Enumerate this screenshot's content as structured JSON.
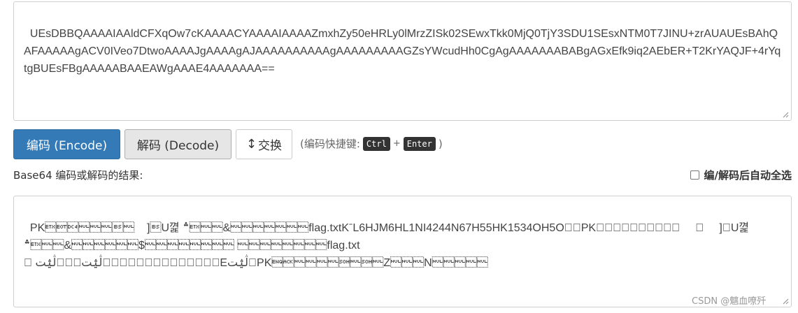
{
  "input": {
    "text": "UEsDBBQAAAAIAAldCFXqOw7cKAAAACYAAAAIAAAAZmxhZy50eHRLy0lMrzZISk02SEwxTkk0MjQ0TjY3SDU1SEsxNTM0T7JINU+zrAUAUEsBAhQAFAAAAAgACV0IVeo7DtwoAAAAJgAAAAgAJAAAAAAAAAAgAAAAAAAAAGZsYWcudHh0CgAgAAAAAAABABgAGxEfk9iq2AEbER+T2KrYAQJF+4rYqtgBUEsFBgAAAAABAAEAWgAAAE4AAAAAAA=="
  },
  "buttons": {
    "encode": "编码 (Encode)",
    "decode": "解码 (Decode)",
    "swap_arrow": "↕",
    "swap": "交换"
  },
  "hint": {
    "prefix": "(编码快捷键:",
    "key1": "Ctrl",
    "plus": "+",
    "key2": "Enter",
    "suffix": ")"
  },
  "result": {
    "label": "Base64 编码或解码的结果:",
    "auto_select": "编/解码后自动全选",
    "auto_select_checked": false,
    "text": "PK\u0003\u0004\u0014\u0000\u0000\u0000\b\u0000    ]\bU꼁 ؞\u0003\u0000\u0000&\u0000\u0000\u0000\u0000\u0000\u0000\u0000flag.txtKˉL6HJM6HL1NI4244N67H55HK1534OH5O\u0000\u0000PK\u0001\u0002\u0014\u0000\u0014\u0000\u0000\u0000\b\u0000\t\u0000     ]\bU꼁\n؞\u0003\u0000\u0000&\u0000\u0000\u0000\u0000\u0000\u0000$\u0000\u0000\u0000\u0000\u0000\u0000\u0000\u0000 \u0000\u0000\u0000\u0000\u0000\u0000\u0000\u0000flag.txt\n\u0000 \u0000\u0000\u0000\u0000\u0000\u0000\u0000\u0000\u0000\u0000\u0000\u0000\u0000ڷؿت\u0000\u0000\u0000ڷؿت\u0000Eڷؿت\u0000PK\u0005\u0006\u0000\u0000\u0000\u0000\u0001\u0000\u0001\u0000Z\u0000\u0000\u0000N\u0000\u0000\u0000\u0000\u0000"
  },
  "watermark": "CSDN @魑血嘹歼"
}
